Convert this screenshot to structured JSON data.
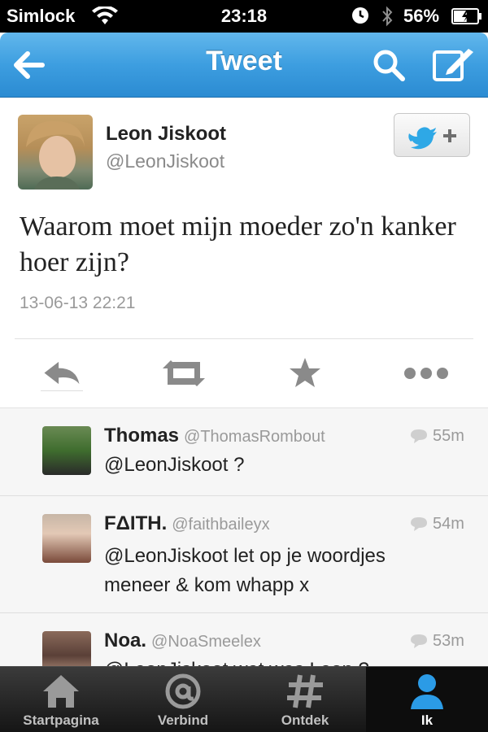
{
  "status_bar": {
    "carrier": "Simlock",
    "time": "23:18",
    "battery": "56%",
    "battery_level": 0.56
  },
  "nav": {
    "title": "Tweet",
    "back_icon": "back-arrow-icon",
    "search_icon": "search-icon",
    "compose_icon": "compose-icon"
  },
  "tweet": {
    "author_name": "Leon Jiskoot",
    "author_handle": "@LeonJiskoot",
    "text": "Waarom moet mijn moeder zo'n kanker hoer zijn?",
    "timestamp": "13-06-13 22:21",
    "actions": [
      "reply",
      "retweet",
      "favorite",
      "more"
    ]
  },
  "replies": [
    {
      "name": "Thomas",
      "handle": "@ThomasRombout",
      "ago": "55m",
      "text": "@LeonJiskoot ?"
    },
    {
      "name": "FΔITH.",
      "handle": "@faithbaileyx",
      "ago": "54m",
      "text": "@LeonJiskoot let op je woordjes meneer & kom whapp x"
    },
    {
      "name": "Noa.",
      "handle": "@NoaSmeelex",
      "ago": "53m",
      "text": "@LeonJiskoot wat was Leon ?"
    }
  ],
  "tabbar": {
    "items": [
      {
        "label": "Startpagina",
        "icon": "home-icon"
      },
      {
        "label": "Verbind",
        "icon": "at-icon"
      },
      {
        "label": "Ontdek",
        "icon": "hash-icon"
      },
      {
        "label": "Ik",
        "icon": "person-icon"
      }
    ],
    "active": "Ik"
  },
  "colors": {
    "nav_blue": "#3d9ee0",
    "twitter_blue": "#2ea8e6",
    "tab_active": "#2b9be6"
  }
}
